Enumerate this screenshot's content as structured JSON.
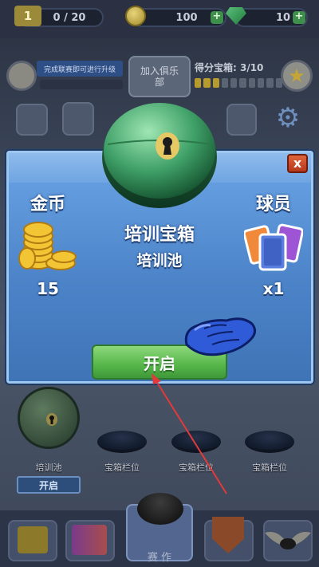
{
  "topbar": {
    "level": "1",
    "level_progress": "0 / 20",
    "coins": "100",
    "gems": "10",
    "plus_symbol": "+"
  },
  "season": {
    "banner_text": "完成联赛即可进行升级",
    "join_button_label": "加入俱乐部",
    "points_chest_label": "得分宝箱: 3/10",
    "points_chest_progress": 0.3
  },
  "modal": {
    "close_symbol": "x",
    "left_reward_label": "金币",
    "left_reward_value": "15",
    "right_reward_label": "球员",
    "right_reward_value": "x1",
    "chest_name": "培训宝箱",
    "chest_source": "培训池",
    "open_button_label": "开启"
  },
  "slots": {
    "chest_slot_label": "培训池",
    "chest_open_label": "开启",
    "empty_slot_label": "宝箱栏位",
    "empty_slots": [
      "宝箱栏位",
      "宝箱栏位",
      "宝箱栏位"
    ]
  },
  "bottom_nav": {
    "center_label": "赛 作"
  },
  "colors": {
    "modal_blue": "#5b92d8",
    "open_green": "#56b64a",
    "close_red": "#c4452a",
    "annotation_arrow": "#e23a3a"
  }
}
